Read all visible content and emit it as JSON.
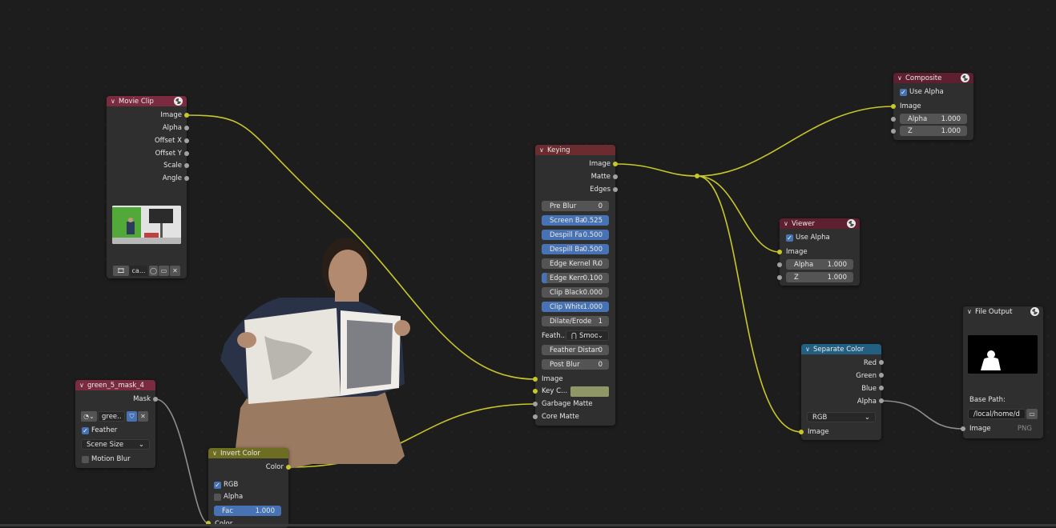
{
  "colors": {
    "background": "#1d1d1d",
    "node_body": "#2f2f2f",
    "header_input": "#7b2b3f",
    "header_keying": "#6a2c2f",
    "header_output": "#5e1f30",
    "header_invert": "#6e6e22",
    "header_separate": "#235f80",
    "image_socket": "#c7c729",
    "value_socket": "#a1a1a1",
    "link_image": "#c7c729",
    "link_value": "#8e8e8e",
    "active_blue": "#4772b3",
    "key_color_swatch": "#8f9766"
  },
  "movie_clip": {
    "title": "Movie Clip",
    "outputs": [
      "Image",
      "Alpha",
      "Offset X",
      "Offset Y",
      "Scale",
      "Angle"
    ],
    "clip_name": "ca...",
    "icons": [
      "clip-icon",
      "fake-user-icon",
      "folder-icon",
      "close-icon"
    ]
  },
  "keying": {
    "title": "Keying",
    "outputs": [
      "Image",
      "Matte",
      "Edges"
    ],
    "params": [
      {
        "label": "Pre Blur",
        "value": "0",
        "style": "plain"
      },
      {
        "label": "Screen Ba",
        "value": "0.525",
        "style": "blue"
      },
      {
        "label": "Despill Fa",
        "value": "0.500",
        "style": "blue"
      },
      {
        "label": "Despill Ba",
        "value": "0.500",
        "style": "blue"
      },
      {
        "label": "Edge Kernel Ra",
        "value": "0",
        "style": "plain"
      },
      {
        "label": "Edge Kern",
        "value": "0.100",
        "style": "bluepart"
      },
      {
        "label": "Clip Black",
        "value": "0.000",
        "style": "plain"
      },
      {
        "label": "Clip White",
        "value": "1.000",
        "style": "blue"
      },
      {
        "label": "Dilate/Erode",
        "value": "1",
        "style": "plain"
      }
    ],
    "feather_falloff_label": "Feath...",
    "feather_falloff_value": "Smooth",
    "params2": [
      {
        "label": "Feather Distan",
        "value": "0",
        "style": "plain"
      },
      {
        "label": "Post Blur",
        "value": "0",
        "style": "plain"
      }
    ],
    "inputs": [
      "Image",
      "Key C...",
      "Garbage Matte",
      "Core Matte"
    ]
  },
  "composite": {
    "title": "Composite",
    "use_alpha": "Use Alpha",
    "input_image": "Image",
    "alpha_label": "Alpha",
    "alpha_value": "1.000",
    "z_label": "Z",
    "z_value": "1.000"
  },
  "viewer": {
    "title": "Viewer",
    "use_alpha": "Use Alpha",
    "input_image": "Image",
    "alpha_label": "Alpha",
    "alpha_value": "1.000",
    "z_label": "Z",
    "z_value": "1.000"
  },
  "separate_color": {
    "title": "Separate Color",
    "outputs": [
      "Red",
      "Green",
      "Blue",
      "Alpha"
    ],
    "mode": "RGB",
    "input_image": "Image"
  },
  "file_output": {
    "title": "File Output",
    "base_path_label": "Base Path:",
    "base_path_value": "/local/home/ds...",
    "input_image": "Image",
    "format": "PNG"
  },
  "mask": {
    "title": "green_5_mask_4",
    "output": "Mask",
    "mask_name": "gree...",
    "feather": "Feather",
    "size_source": "Scene Size",
    "motion_blur": "Motion Blur"
  },
  "invert": {
    "title": "Invert Color",
    "output": "Color",
    "rgb": "RGB",
    "alpha": "Alpha",
    "fac_label": "Fac",
    "fac_value": "1.000",
    "input_color": "Color"
  }
}
